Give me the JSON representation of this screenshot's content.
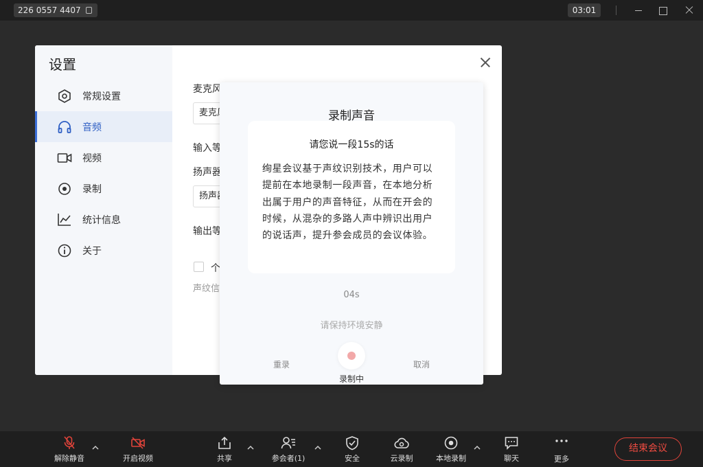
{
  "titlebar": {
    "meeting_id": "226 0557 4407",
    "timer": "03:01"
  },
  "settings": {
    "title": "设置",
    "nav": [
      {
        "label": "常规设置",
        "icon": "gear-icon"
      },
      {
        "label": "音频",
        "icon": "headphones-icon"
      },
      {
        "label": "视频",
        "icon": "video-camera-icon"
      },
      {
        "label": "录制",
        "icon": "record-icon"
      },
      {
        "label": "统计信息",
        "icon": "line-chart-icon"
      },
      {
        "label": "关于",
        "icon": "info-icon"
      }
    ],
    "active_nav": "音频",
    "audio": {
      "mic_label": "麦克风",
      "mic_value": "麦克风",
      "input_level_label": "输入等",
      "speaker_label": "扬声器",
      "speaker_value": "扬声器",
      "output_level_label": "输出等",
      "checkbox_label": "个",
      "voice_info": "声纹信"
    }
  },
  "record_dialog": {
    "title": "录制声音",
    "heading": "请您说一段15s的话",
    "body": "绚星会议基于声纹识别技术，用户可以提前在本地录制一段声音，在本地分析出属于用户的声音特征，从而在开会的时候，从混杂的多路人声中辨识出用户的说话声，提升参会成员的会议体验。",
    "elapsed": "04s",
    "hint": "请保持环境安静",
    "rerecord_label": "重录",
    "cancel_label": "取消",
    "status_label": "录制中",
    "dot_color": "#f2a8a8"
  },
  "toolbar": {
    "unmute": "解除静音",
    "start_video": "开启视频",
    "share": "共享",
    "participants": "参会者(1)",
    "security": "安全",
    "cloud_record": "云录制",
    "local_record": "本地录制",
    "chat": "聊天",
    "more": "更多",
    "end_meeting": "结束会议",
    "alert_color": "#e0433a"
  }
}
